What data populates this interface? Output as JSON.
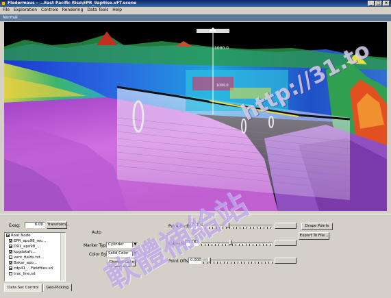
{
  "window": {
    "title": "Fledermaus - ...East Pacific Rise\\EPR_9ap9ise.vFT.scene"
  },
  "menu": [
    "File",
    "Exploration",
    "Controls",
    "Rendering",
    "Data Tools",
    "Help"
  ],
  "mode_bar": "Normal",
  "scene": {
    "depth_label": "1000.0",
    "marker_label": "1000.0",
    "colors": {
      "low": "#c060d0",
      "mid": "#30c0e0",
      "high": "#f04020",
      "green": "#40c040"
    }
  },
  "controls": {
    "exag_label": "Exag:",
    "exag_value": "6.00",
    "transform_label": "Transform...",
    "auto_label": "Auto",
    "tree_root": "Root Node",
    "tree_items": [
      "EPR_apo98_rec...",
      "D91_apo98_...",
      "kpgdatafc...",
      "vent_fields.txt...",
      "Bakar_apo...",
      "cdp41_...Fieldfiles.sd",
      "trac_line.sd"
    ],
    "marker_type_label": "Marker Type",
    "marker_type_value": "Cylinder",
    "color_by_label": "Color By",
    "color_by_value": "Solid Color",
    "change_color_label": "Change Color",
    "point_radius_label": "Point Radius",
    "point_radius_value": "0.306",
    "point_radius_level": 0.33,
    "label_size_label": "Label Size",
    "label_size_value": "0.582",
    "label_size_level": 0.41,
    "point_offset_label": "Point Offset",
    "point_offset_value": "0.000",
    "point_offset_level": 0.07,
    "drape_points_label": "Drape Points",
    "export_label": "Export To File..."
  },
  "tabs": [
    "Data Set Control",
    "Geo-Picking"
  ],
  "watermark": {
    "url": "http://31.to",
    "cjk": "軟體補給站"
  }
}
